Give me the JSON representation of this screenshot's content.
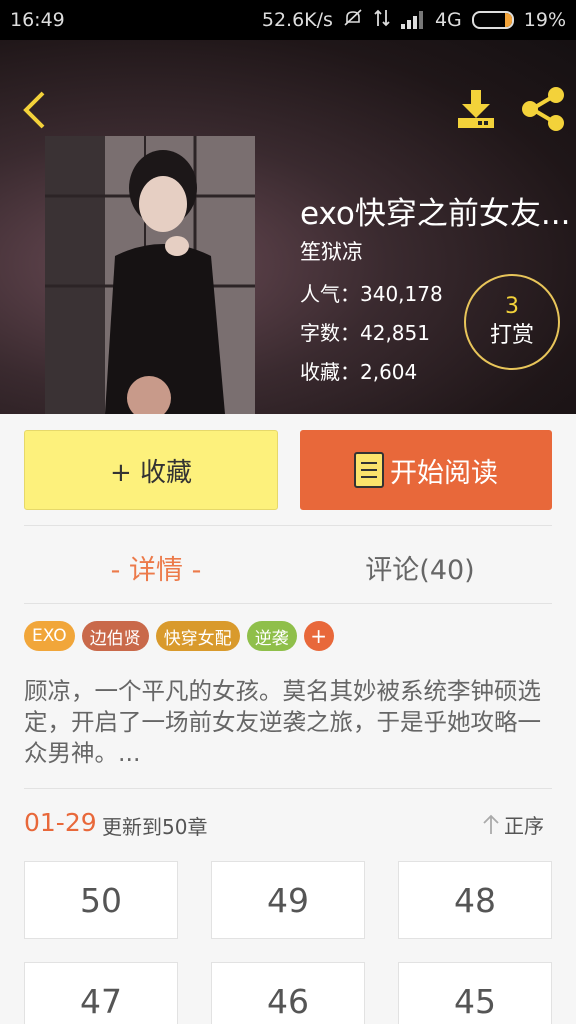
{
  "status_bar": {
    "time": "16:49",
    "net_speed": "52.6K/s",
    "network": "4G",
    "battery_level": 0.19,
    "battery_text": "19%"
  },
  "book": {
    "title": "exo快穿之前女友...",
    "author": "笙狱凉",
    "popularity": "人气：340,178",
    "word_count": "字数：42,851",
    "favorites": "收藏：2,604",
    "reward_count": "3",
    "reward_label": "打赏"
  },
  "actions": {
    "collect_label": "+ 收藏",
    "read_label": "开始阅读"
  },
  "tabs": {
    "detail": "- 详情 -",
    "comments": "评论(40)"
  },
  "tags": [
    {
      "label": "EXO",
      "color": "#f1a63a"
    },
    {
      "label": "边伯贤",
      "color": "#c9694a"
    },
    {
      "label": "快穿女配",
      "color": "#d99a2c"
    },
    {
      "label": "逆袭",
      "color": "#8fbf4a"
    }
  ],
  "tag_add": "+",
  "synopsis": "顾凉，一个平凡的女孩。莫名其妙被系统李钟硕选定，开启了一场前女友逆袭之旅，于是乎她攻略一众男神。...",
  "updates": {
    "date": "01-29",
    "text": "更新到50章",
    "order_label": "正序"
  },
  "chapters": [
    "50",
    "49",
    "48",
    "47",
    "46",
    "45"
  ],
  "colors": {
    "accent": "#e8683a",
    "highlight": "#f3d23a"
  }
}
